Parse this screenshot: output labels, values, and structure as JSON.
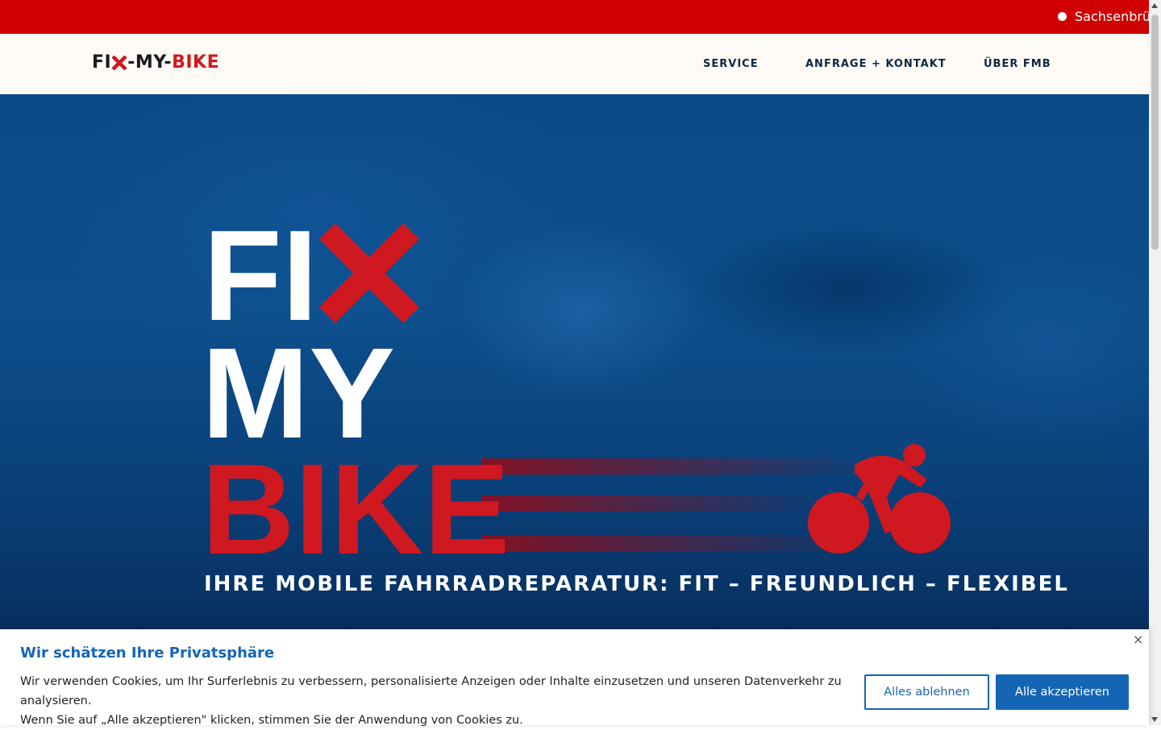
{
  "topbar": {
    "ticker_text": "Sachsenbrü"
  },
  "header": {
    "logo": {
      "part1": "FI",
      "part2": "-MY-",
      "part3": "BIKE"
    },
    "nav": [
      {
        "label": "SERVICE"
      },
      {
        "label": "ANFRAGE + KONTAKT"
      },
      {
        "label": "ÜBER FMB"
      }
    ]
  },
  "hero": {
    "logo_line1": "FI",
    "logo_line2": "MY",
    "logo_line3": "BIKE",
    "tagline": "IHRE MOBILE FAHRRADREPARATUR: FIT – FREUNDLICH – FLEXIBEL"
  },
  "cookie": {
    "title": "Wir schätzen Ihre Privatsphäre",
    "text_line1": "Wir verwenden Cookies, um Ihr Surferlebnis zu verbessern, personalisierte Anzeigen oder Inhalte einzusetzen und unseren Datenverkehr zu analysieren.",
    "text_line2": "Wenn Sie auf „Alle akzeptieren\" klicken, stimmen Sie der Anwendung von Cookies zu.",
    "reject_label": "Alles ablehnen",
    "accept_label": "Alle akzeptieren",
    "close_glyph": "×"
  },
  "colors": {
    "brand_red": "#d01820",
    "topbar_red": "#d00000",
    "hero_blue": "#0d4f8c",
    "nav_dark": "#0f2742",
    "button_blue": "#1565b5"
  },
  "icons": [
    "close-icon",
    "cyclist-icon",
    "x-mark-icon",
    "scroll-up-icon",
    "scroll-down-icon"
  ]
}
